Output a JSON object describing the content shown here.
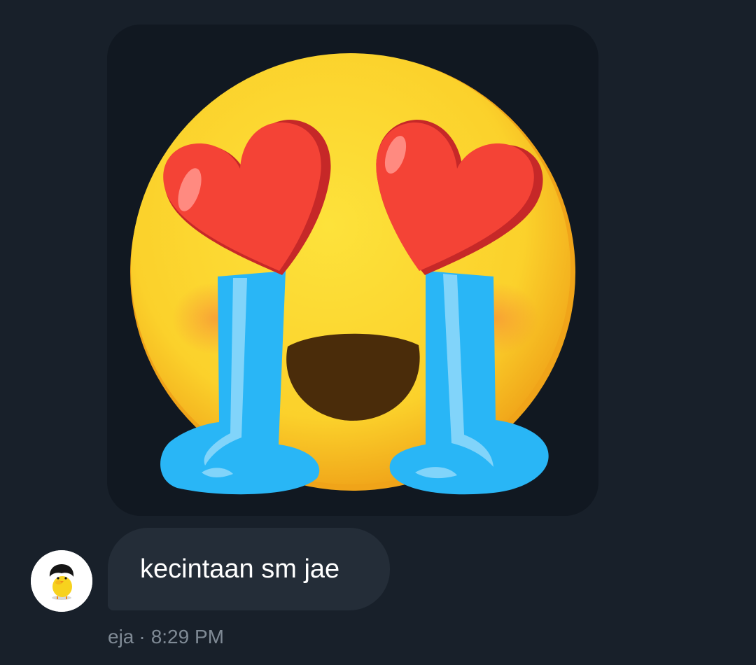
{
  "conversation": {
    "image_message": {
      "content": "emoji-smiling-face-heart-eyes-crying"
    },
    "text_message": {
      "text": "kecintaan sm jae",
      "sender": "eja",
      "separator": "·",
      "time": "8:29 PM"
    },
    "avatar": {
      "description": "yellow-chick-with-black-hair"
    }
  },
  "colors": {
    "background": "#18202a",
    "image_background": "#111821",
    "bubble": "#242d38",
    "message_text": "#ffffff",
    "meta_text": "#7f8a95",
    "face": "#fbd12b",
    "heart": "#f44336",
    "tears": "#29b6f6",
    "mouth": "#4a2c0a"
  }
}
